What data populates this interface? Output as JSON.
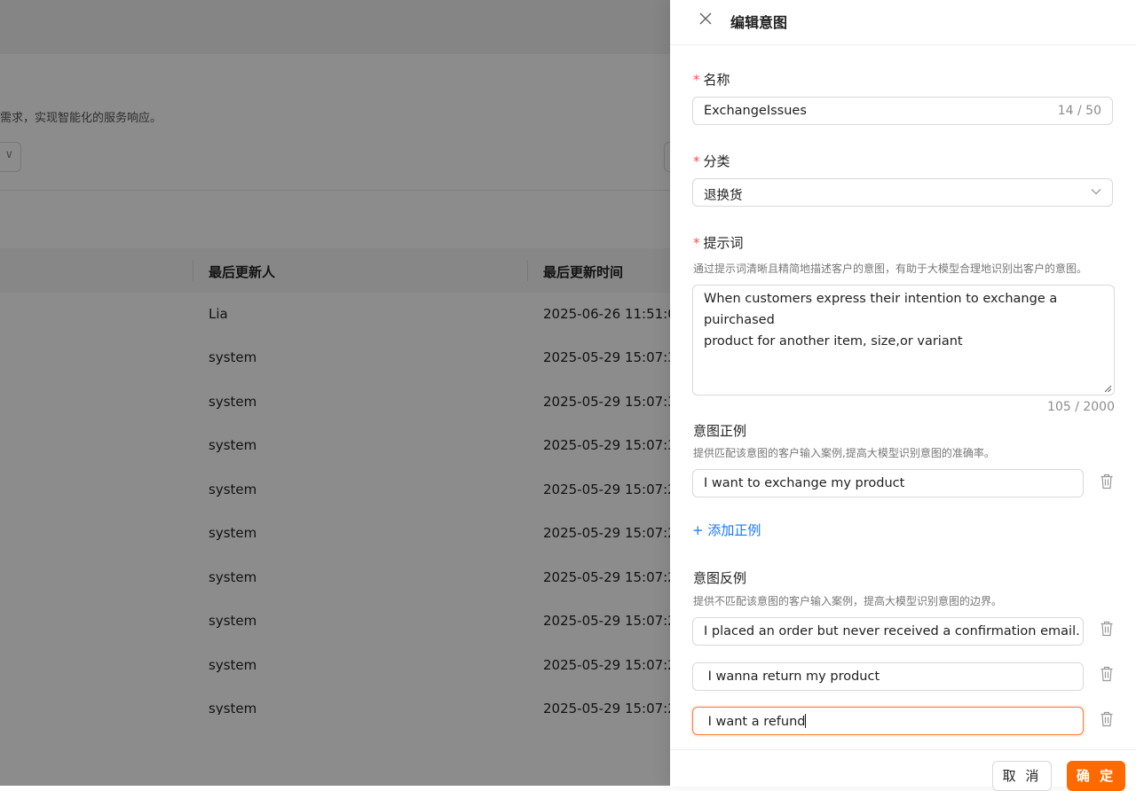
{
  "background": {
    "page_desc": "需求，实现智能化的服务响应。",
    "table": {
      "col_updater": "最后更新人",
      "col_updated_at": "最后更新时间",
      "rows": [
        {
          "updater": "Lia",
          "updated_at": "2025-06-26 11:51:0"
        },
        {
          "updater": "system",
          "updated_at": "2025-05-29 15:07:3"
        },
        {
          "updater": "system",
          "updated_at": "2025-05-29 15:07:3"
        },
        {
          "updater": "system",
          "updated_at": "2025-05-29 15:07:3"
        },
        {
          "updater": "system",
          "updated_at": "2025-05-29 15:07:2"
        },
        {
          "updater": "system",
          "updated_at": "2025-05-29 15:07:2"
        },
        {
          "updater": "system",
          "updated_at": "2025-05-29 15:07:2"
        },
        {
          "updater": "system",
          "updated_at": "2025-05-29 15:07:2"
        },
        {
          "updater": "system",
          "updated_at": "2025-05-29 15:07:2"
        },
        {
          "updater": "system",
          "updated_at": "2025-05-29 15:07:2"
        }
      ]
    }
  },
  "drawer": {
    "title": "编辑意图",
    "required_mark": "*",
    "name": {
      "label": "名称",
      "value": "ExchangeIssues",
      "count": "14 / 50"
    },
    "category": {
      "label": "分类",
      "value": "退换货"
    },
    "prompt": {
      "label": "提示词",
      "hint": "通过提示词清晰且精简地描述客户的意图，有助于大模型合理地识别出客户的意图。",
      "lines": [
        "When customers express their intention to exchange a",
        "puirchased",
        "product for another item, size,or variant"
      ],
      "count": "105 / 2000"
    },
    "positive": {
      "label": "意图正例",
      "hint": "提供匹配该意图的客户输入案例,提高大模型识别意图的准确率。",
      "examples": [
        "I want to exchange my product"
      ],
      "add_label": "+ 添加正例"
    },
    "negative": {
      "label": "意图反例",
      "hint": "提供不匹配该意图的客户输入案例，提高大模型识别意图的边界。",
      "examples": [
        "I placed an order but never received a confirmation email.",
        " I wanna return my product",
        " I want a refund"
      ]
    },
    "footer": {
      "cancel": "取 消",
      "ok": "确 定"
    }
  },
  "colors": {
    "accent": "#ff6a00",
    "link": "#1677ff",
    "required": "#ff4d4f"
  }
}
